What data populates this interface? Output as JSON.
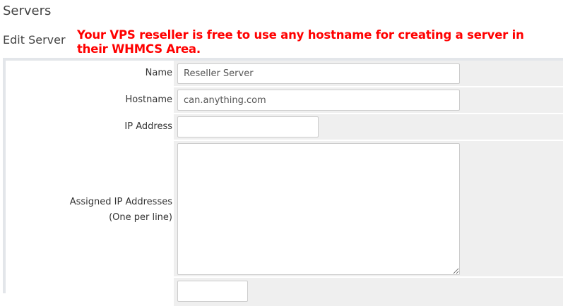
{
  "page_title": "Servers",
  "section_title": "Edit Server",
  "annotation": "Your VPS reseller is free to use any hostname for creating a server in their WHMCS Area.",
  "fields": {
    "name": {
      "label": "Name",
      "value": "Reseller Server"
    },
    "hostname": {
      "label": "Hostname",
      "value": "can.anything.com"
    },
    "ip": {
      "label": "IP Address",
      "value": ""
    },
    "assigned": {
      "label_line1": "Assigned IP Addresses",
      "label_line2": "(One per line)",
      "value": ""
    }
  },
  "colors": {
    "annotation": "#ff0000",
    "cell_bg": "#efefef"
  }
}
